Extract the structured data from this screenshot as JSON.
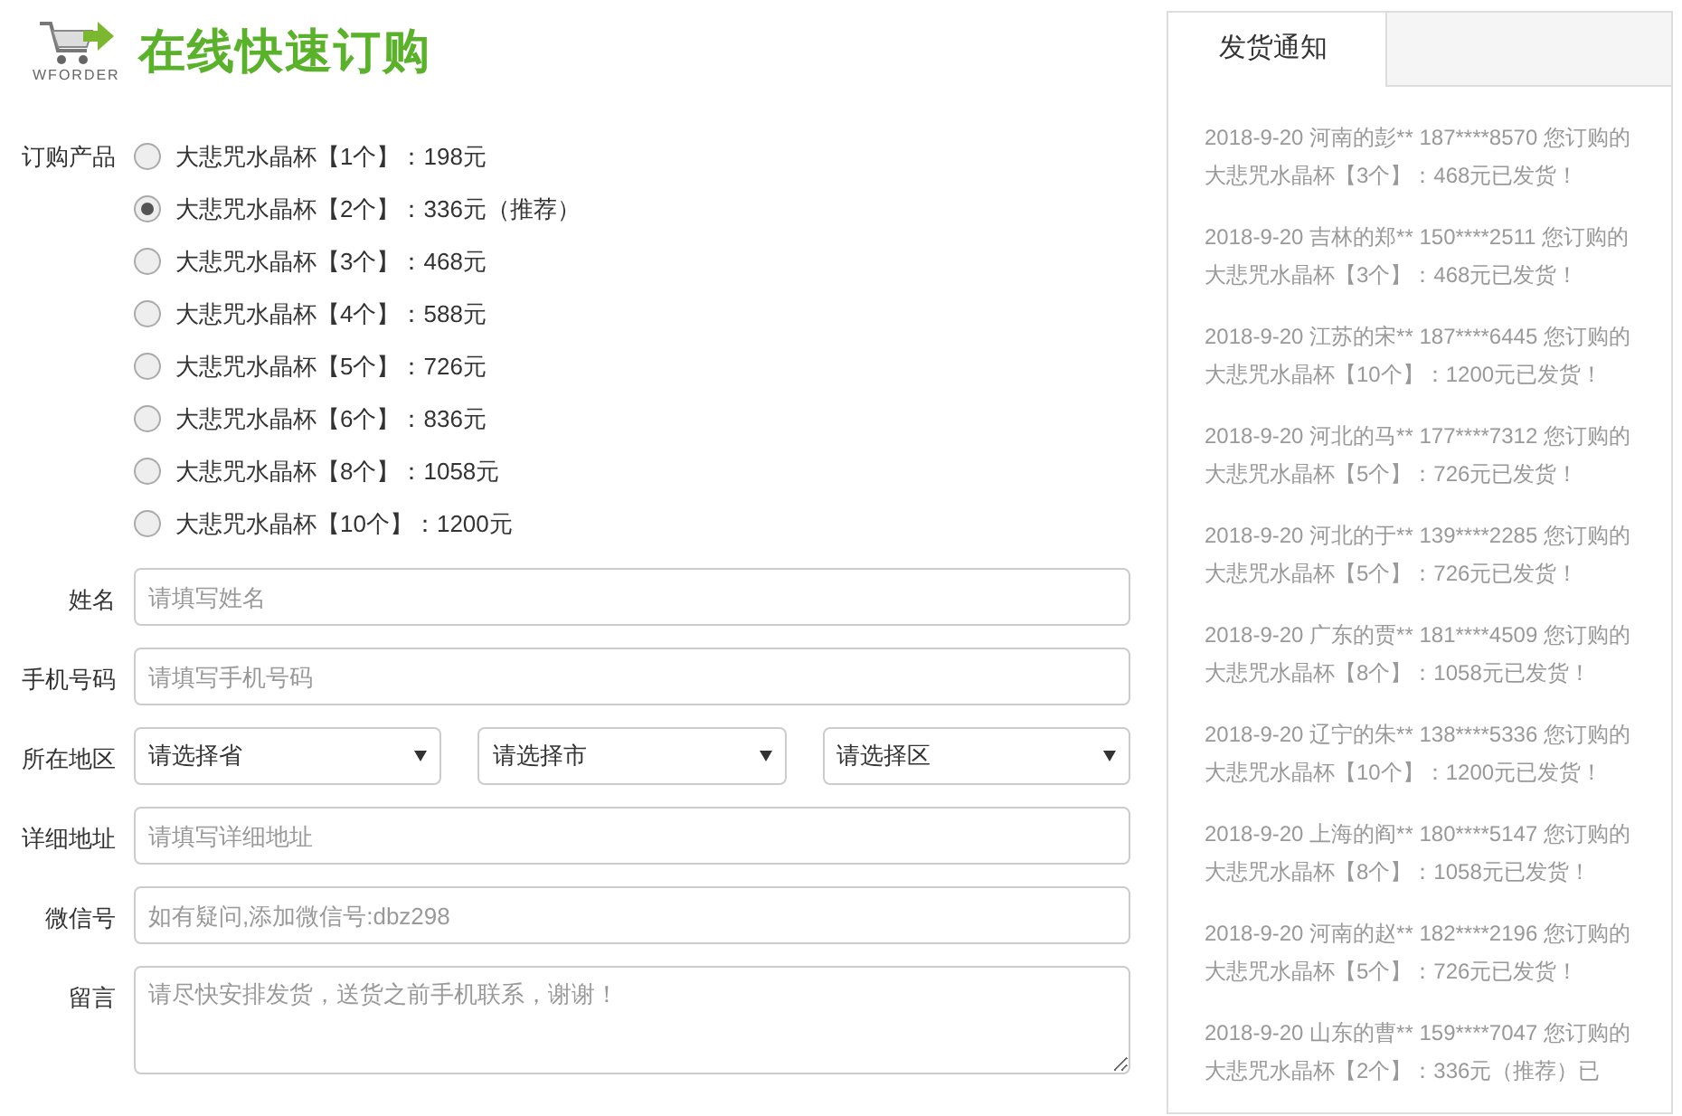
{
  "logo": {
    "caption": "WFORDER",
    "title": "在线快速订购"
  },
  "product": {
    "label": "订购产品",
    "options": [
      {
        "text": "大悲咒水晶杯【1个】：198元",
        "selected": false
      },
      {
        "text": "大悲咒水晶杯【2个】：336元（推荐）",
        "selected": true
      },
      {
        "text": "大悲咒水晶杯【3个】：468元",
        "selected": false
      },
      {
        "text": "大悲咒水晶杯【4个】：588元",
        "selected": false
      },
      {
        "text": "大悲咒水晶杯【5个】：726元",
        "selected": false
      },
      {
        "text": "大悲咒水晶杯【6个】：836元",
        "selected": false
      },
      {
        "text": "大悲咒水晶杯【8个】：1058元",
        "selected": false
      },
      {
        "text": "大悲咒水晶杯【10个】：1200元",
        "selected": false
      }
    ]
  },
  "fields": [
    {
      "kind": "input",
      "label": "姓名",
      "placeholder": "请填写姓名"
    },
    {
      "kind": "input",
      "label": "手机号码",
      "placeholder": "请填写手机号码"
    },
    {
      "kind": "selects",
      "label": "所在地区",
      "options": [
        "请选择省",
        "请选择市",
        "请选择区"
      ]
    },
    {
      "kind": "input",
      "label": "详细地址",
      "placeholder": "请填写详细地址"
    },
    {
      "kind": "input",
      "label": "微信号",
      "placeholder": "如有疑问,添加微信号:dbz298"
    },
    {
      "kind": "textarea",
      "label": "留言",
      "placeholder": "请尽快安排发货，送货之前手机联系，谢谢！"
    }
  ],
  "notice": {
    "tab": "发货通知",
    "items": [
      "2018-9-20 河南的彭** 187****8570 您订购的大悲咒水晶杯【3个】：468元已发货！",
      "2018-9-20 吉林的郑** 150****2511 您订购的大悲咒水晶杯【3个】：468元已发货！",
      "2018-9-20 江苏的宋** 187****6445 您订购的大悲咒水晶杯【10个】：1200元已发货！",
      "2018-9-20 河北的马** 177****7312 您订购的大悲咒水晶杯【5个】：726元已发货！",
      "2018-9-20 河北的于** 139****2285 您订购的大悲咒水晶杯【5个】：726元已发货！",
      "2018-9-20 广东的贾** 181****4509 您订购的大悲咒水晶杯【8个】：1058元已发货！",
      "2018-9-20 辽宁的朱** 138****5336 您订购的大悲咒水晶杯【10个】：1200元已发货！",
      "2018-9-20 上海的阎** 180****5147 您订购的大悲咒水晶杯【8个】：1058元已发货！",
      "2018-9-20 河南的赵** 182****2196 您订购的大悲咒水晶杯【5个】：726元已发货！",
      "2018-9-20 山东的曹** 159****7047 您订购的大悲咒水晶杯【2个】：336元（推荐）已"
    ]
  }
}
